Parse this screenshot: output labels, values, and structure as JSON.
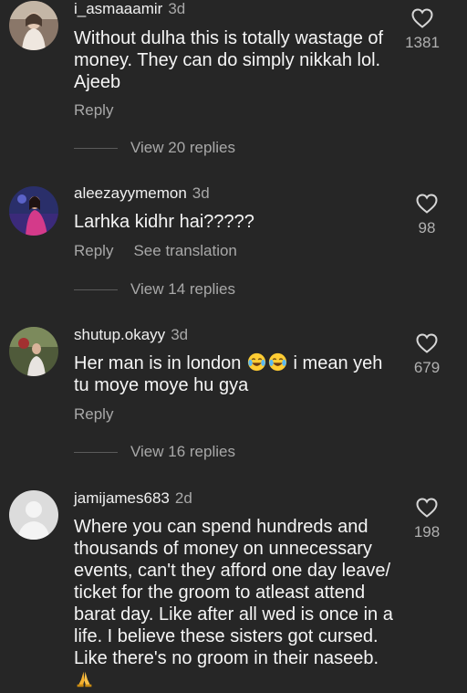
{
  "comments": [
    {
      "username": "i_asmaaamir",
      "time": "3d",
      "text": "Without dulha this is totally wastage of money. They can do simply nikkah lol. Ajeeb",
      "reply_label": "Reply",
      "likes": "1381",
      "view_replies": "View 20 replies"
    },
    {
      "username": "aleezayymemon",
      "time": "3d",
      "text": "Larhka kidhr hai?????",
      "reply_label": "Reply",
      "translate_label": "See translation",
      "likes": "98",
      "view_replies": "View 14 replies"
    },
    {
      "username": "shutup.okayy",
      "time": "3d",
      "text_before": "Her man is in london ",
      "emoji": [
        "face-with-tears-of-joy",
        "face-with-tears-of-joy"
      ],
      "text_after": " i mean yeh tu moye moye hu gya",
      "reply_label": "Reply",
      "likes": "679",
      "view_replies": "View 16 replies"
    },
    {
      "username": "jamijames683",
      "time": "2d",
      "text": "Where you can spend hundreds and thousands of money on unnecessary events, can't they afford one day leave/ ticket for the groom to atleast attend barat day. Like after all wed is once in a life. I believe these sisters got cursed. Like there's no groom in their naseeb.",
      "emoji": [
        "folded-hands"
      ],
      "likes": "198"
    }
  ],
  "colors": {
    "background": "#262626",
    "primary_text": "#f5f5f5",
    "secondary_text": "#a8a8a8"
  }
}
